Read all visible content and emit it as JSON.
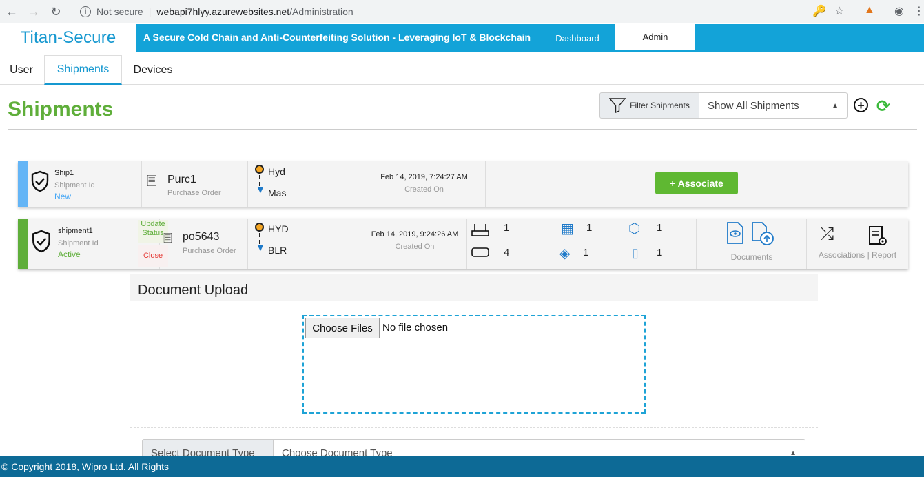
{
  "browser": {
    "security": "Not secure",
    "url_host": "webapi7hlyy.azurewebsites.net",
    "url_path": "/Administration"
  },
  "header": {
    "brand": "Titan-Secure",
    "banner": "A Secure Cold Chain and Anti-Counterfeiting Solution - Leveraging IoT & Blockchain",
    "nav": [
      "Dashboard",
      "Admin"
    ],
    "active_nav": "Admin"
  },
  "tabs": [
    "User",
    "Shipments",
    "Devices"
  ],
  "active_tab": "Shipments",
  "page": {
    "title": "Shipments",
    "filter_label": "Filter Shipments",
    "filter_value": "Show All Shipments"
  },
  "shipments": [
    {
      "id": "Ship1",
      "id_label": "Shipment Id",
      "status": "New",
      "po": "Purc1",
      "po_label": "Purchase Order",
      "from": "Hyd",
      "to": "Mas",
      "created": "Feb 14, 2019, 7:24:27 AM",
      "created_label": "Created On",
      "action": "+ Associate"
    },
    {
      "id": "shipment1",
      "id_label": "Shipment Id",
      "status": "Active",
      "update_status": "Update Status",
      "close": "Close",
      "po": "po5643",
      "po_label": "Purchase Order",
      "from": "HYD",
      "to": "BLR",
      "created": "Feb 14, 2019, 9:24:26 AM",
      "created_label": "Created On",
      "counts": {
        "router": "1",
        "tray": "4",
        "pallet": "1",
        "box": "1",
        "package": "1",
        "container": "1"
      },
      "documents_label": "Documents",
      "assoc_label": "Associations | Report"
    }
  ],
  "upload": {
    "title": "Document Upload",
    "choose": "Choose Files",
    "no_file": "No file chosen",
    "doc_type_label": "Select Document Type",
    "doc_type_value": "Choose Document Type"
  },
  "footer": "© Copyright 2018, Wipro Ltd. All Rights",
  "colors": {
    "brand_blue": "#13a3d8",
    "green": "#5fb832",
    "new_blue": "#42a5f5"
  }
}
